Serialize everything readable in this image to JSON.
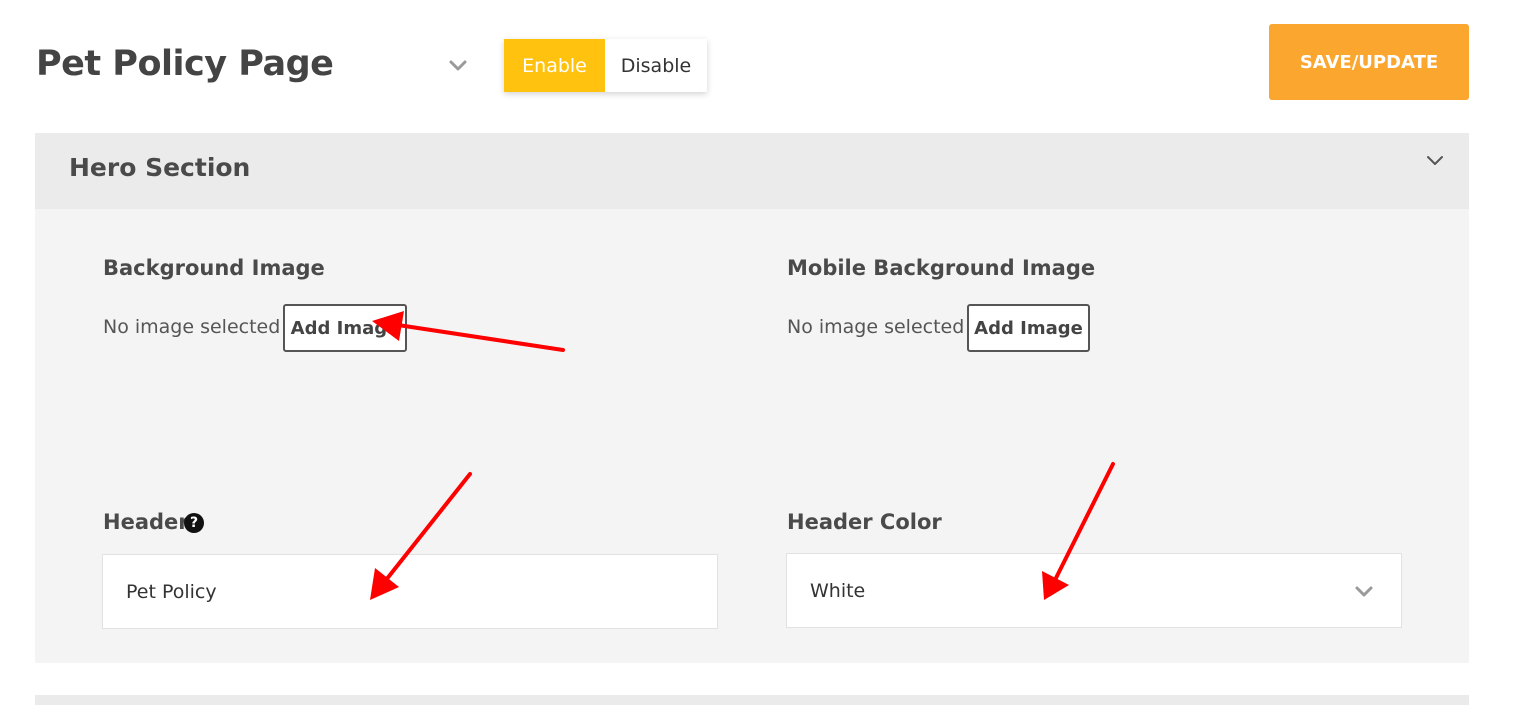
{
  "header": {
    "title": "Pet Policy Page",
    "toggle": {
      "enable_label": "Enable",
      "disable_label": "Disable",
      "selected": "Enable"
    },
    "save_label": "SAVE/UPDATE"
  },
  "hero_section": {
    "title": "Hero Section",
    "background_image": {
      "label": "Background Image",
      "status": "No image selected",
      "button_label": "Add Image"
    },
    "mobile_background_image": {
      "label": "Mobile Background Image",
      "status": "No image selected",
      "button_label": "Add Image"
    },
    "header_field": {
      "label": "Header",
      "value": "Pet Policy"
    },
    "header_color": {
      "label": "Header Color",
      "value": "White"
    }
  },
  "icons": {
    "title_chevron": "chevron-down-icon",
    "section_chevron": "chevron-down-icon",
    "help": "question-circle-icon",
    "select_chevron": "chevron-down-icon"
  },
  "colors": {
    "enable_active": "#ffc20e",
    "save_button": "#fba62f",
    "section_header_bg": "#ebebeb",
    "section_body_bg": "#f4f4f4",
    "annotation_arrow": "#ff0000"
  }
}
